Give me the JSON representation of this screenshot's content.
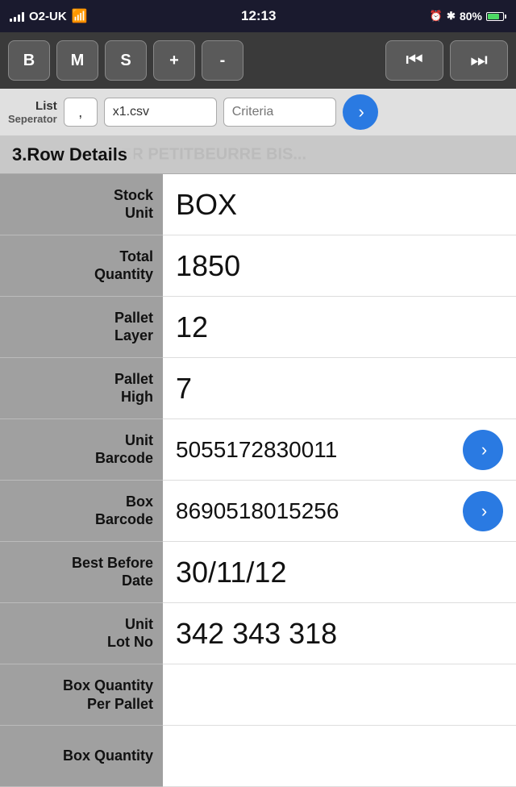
{
  "statusBar": {
    "carrier": "O2-UK",
    "time": "12:13",
    "battery": "80%",
    "batteryCharging": true
  },
  "toolbar": {
    "btnB": "B",
    "btnM": "M",
    "btnS": "S",
    "btnPlus": "+",
    "btnMinus": "-",
    "btnPrev": "⏮",
    "btnNext": "⏭"
  },
  "filterBar": {
    "listLabel": "List",
    "separatorLabel": "Seperator",
    "separatorValue": ",",
    "fileValue": "x1.csv",
    "criteriaPlaceholder": "Criteria",
    "goLabel": "Go"
  },
  "rowDetailsHeader": {
    "title": "3.Row Details",
    "bgText": "ER PETITBEURRE BIS..."
  },
  "rows": [
    {
      "label": "Stock\nUnit",
      "value": "BOX",
      "hasBtn": false
    },
    {
      "label": "Total\nQuantity",
      "value": "1850",
      "hasBtn": false
    },
    {
      "label": "Pallet\nLayer",
      "value": "12",
      "hasBtn": false
    },
    {
      "label": "Pallet\nHigh",
      "value": "7",
      "hasBtn": false
    },
    {
      "label": "Unit\nBarcode",
      "value": "5055172830011",
      "hasBtn": true
    },
    {
      "label": "Box\nBarcode",
      "value": "8690518015256",
      "hasBtn": true
    },
    {
      "label": "Best Before\nDate",
      "value": "30/11/12",
      "hasBtn": false
    },
    {
      "label": "Unit\nLot No",
      "value": "342 343 318",
      "hasBtn": false
    },
    {
      "label": "Box Quantity\nPer Pallet",
      "value": "",
      "hasBtn": false
    },
    {
      "label": "Box Quantity",
      "value": "",
      "hasBtn": false
    }
  ]
}
